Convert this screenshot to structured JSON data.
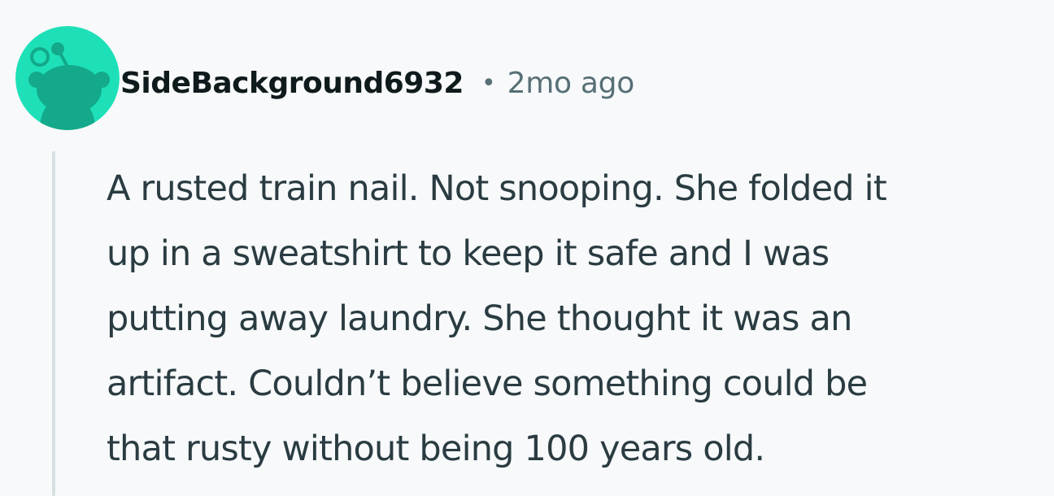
{
  "comment": {
    "author": "SideBackground6932",
    "separator": "•",
    "timestamp": "2mo ago",
    "body_lines": [
      "A rusted train nail. Not snooping. She folded it",
      "up in a sweatshirt to keep it safe and I was",
      "putting away laundry. She thought it was an",
      "artifact. Couldn’t believe something could be",
      "that rusty without being 100 years old."
    ],
    "avatar": {
      "icon": "snoo-avatar-icon",
      "background_color": "#1ee0b8",
      "figure_color": "#13a98a"
    },
    "colors": {
      "username": "#0f1a1c",
      "meta": "#576f76",
      "body": "#2a3c42",
      "thread_line": "#d7e0e3",
      "background": "#f7f9fa"
    }
  }
}
